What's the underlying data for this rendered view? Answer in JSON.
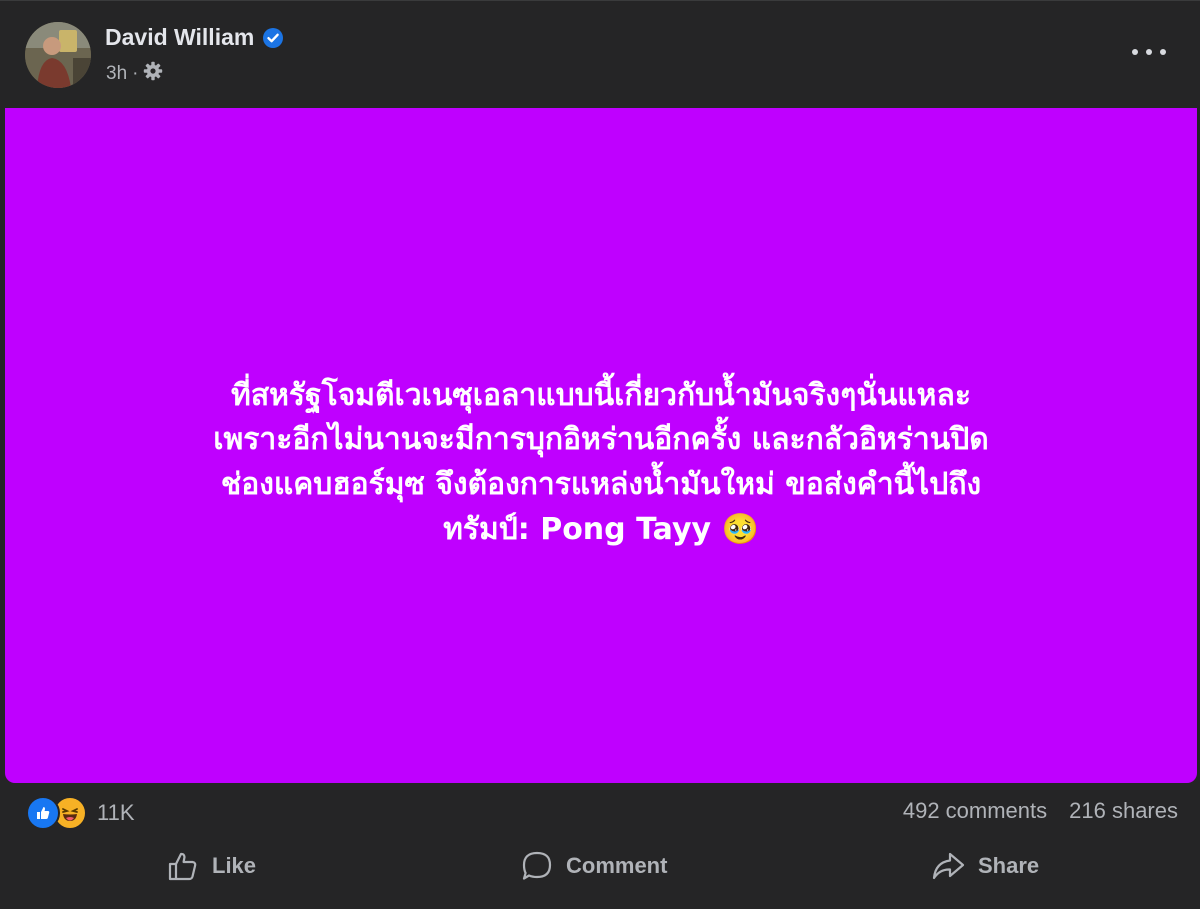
{
  "post": {
    "author": "David William",
    "time": "3h",
    "separator": "·",
    "text_lines": [
      "ที่สหรัฐโจมตีเวเนซุเอลาแบบนี้เกี่ยวกับน้ำมันจริงๆ￼นั่นแหละ",
      "เพราะอีกไม่นานจะมีการบุกอิหร่านอีกครั้ง และกลัวอิหร่านปิด",
      "ช่องแคบฮอร์มุซ จึงต้องการแหล่งน้ำมันใหม่ ขอส่งคำนี้ไปถึง",
      "ทรัมป์: Pong Tayy 🥹"
    ],
    "background_color": "#bf00ff"
  },
  "stats": {
    "reaction_count": "11K",
    "comments": "492 comments",
    "shares": "216 shares",
    "reaction_icons": [
      "like-icon",
      "haha-icon"
    ]
  },
  "actions": {
    "like_label": "Like",
    "comment_label": "Comment",
    "share_label": "Share"
  },
  "icons": {
    "verified": "verified-badge-icon",
    "audience": "gear-icon",
    "more": "more-options-icon"
  }
}
